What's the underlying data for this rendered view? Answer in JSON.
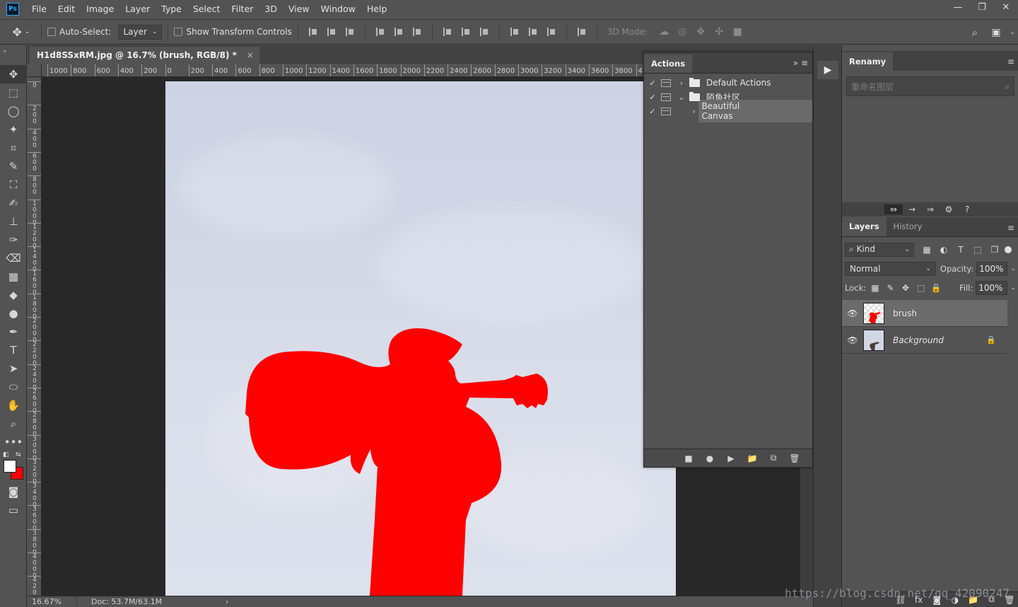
{
  "app": {
    "logo": "Ps"
  },
  "menu": [
    "File",
    "Edit",
    "Image",
    "Layer",
    "Type",
    "Select",
    "Filter",
    "3D",
    "View",
    "Window",
    "Help"
  ],
  "window_controls": {
    "minimize": "—",
    "restore": "❐",
    "close": "✕"
  },
  "options": {
    "auto_select_label": "Auto-Select:",
    "auto_select_target": "Layer",
    "show_transform_label": "Show Transform Controls",
    "mode3d_label": "3D Mode:"
  },
  "document": {
    "tab_title": "H1d8SSxRM.jpg @ 16.7% (brush, RGB/8) *",
    "close": "×",
    "zoom": "16.67%",
    "doc_info": "Doc: 53.7M/63.1M",
    "status_arrow": "›"
  },
  "ruler_h": [
    "1000",
    "800",
    "600",
    "400",
    "200",
    "0",
    "200",
    "400",
    "600",
    "800",
    "1000",
    "1200",
    "1400",
    "1600",
    "1800",
    "2000",
    "2200",
    "2400",
    "2600",
    "2800",
    "3000",
    "3200",
    "3400",
    "3600",
    "3800",
    "4"
  ],
  "ruler_v": [
    "0",
    "2\n0\n0",
    "4\n0\n0",
    "6\n0\n0",
    "8\n0\n0",
    "1\n0\n0\n0",
    "1\n2\n0\n0",
    "1\n4\n0\n0",
    "1\n6\n0\n0",
    "1\n8\n0\n0",
    "2\n0\n0\n0",
    "2\n2\n0\n0",
    "2\n4\n0\n0",
    "2\n6\n0\n0",
    "2\n8\n0\n0",
    "3\n0\n0\n0",
    "3\n2\n0\n0",
    "3\n4\n0\n0",
    "3\n6\n0\n0",
    "3\n8\n0\n0",
    "4\n0\n0\n0",
    "4\n2\n0\n0"
  ],
  "actions_panel": {
    "tab": "Actions",
    "rows": [
      {
        "checked": "✓",
        "chevron": "›",
        "label": "Default Actions",
        "type": "set"
      },
      {
        "checked": "✓",
        "chevron": "⌄",
        "label": "陌鱼社区",
        "type": "set"
      },
      {
        "checked": "✓",
        "chevron": "›",
        "label": "Beautiful Canvas",
        "type": "action"
      }
    ],
    "footer": [
      "■",
      "●",
      "▶",
      "📁",
      "⧉",
      "🗑"
    ]
  },
  "renamy_panel": {
    "tab": "Renamy",
    "search_placeholder": "重命名图层",
    "toolbar": [
      "⇔",
      "→",
      "⇒",
      "⚙",
      "?"
    ]
  },
  "layers_panel": {
    "tabs": [
      "Layers",
      "History"
    ],
    "kind_label": "Kind",
    "filter_icons": [
      "▦",
      "◐",
      "T",
      "⬚",
      "❐"
    ],
    "blend_mode": "Normal",
    "opacity_label": "Opacity:",
    "opacity": "100%",
    "lock_label": "Lock:",
    "lock_icons": [
      "▦",
      "✎",
      "✥",
      "⬚",
      "🔒"
    ],
    "fill_label": "Fill:",
    "fill": "100%",
    "layers": [
      {
        "name": "brush",
        "visible": "👁",
        "selected": true,
        "italic": false
      },
      {
        "name": "Background",
        "visible": "👁",
        "selected": false,
        "italic": true,
        "locked": "🔒"
      }
    ],
    "footer": [
      "⛓",
      "fx",
      "◙",
      "◑",
      "📁",
      "⧉",
      "🗑"
    ]
  },
  "watermark": "https://blog.csdn.net/qq_42090247",
  "colors": {
    "foreground": "#ffffff",
    "background": "#ff0000",
    "silhouette": "#ff0000"
  }
}
